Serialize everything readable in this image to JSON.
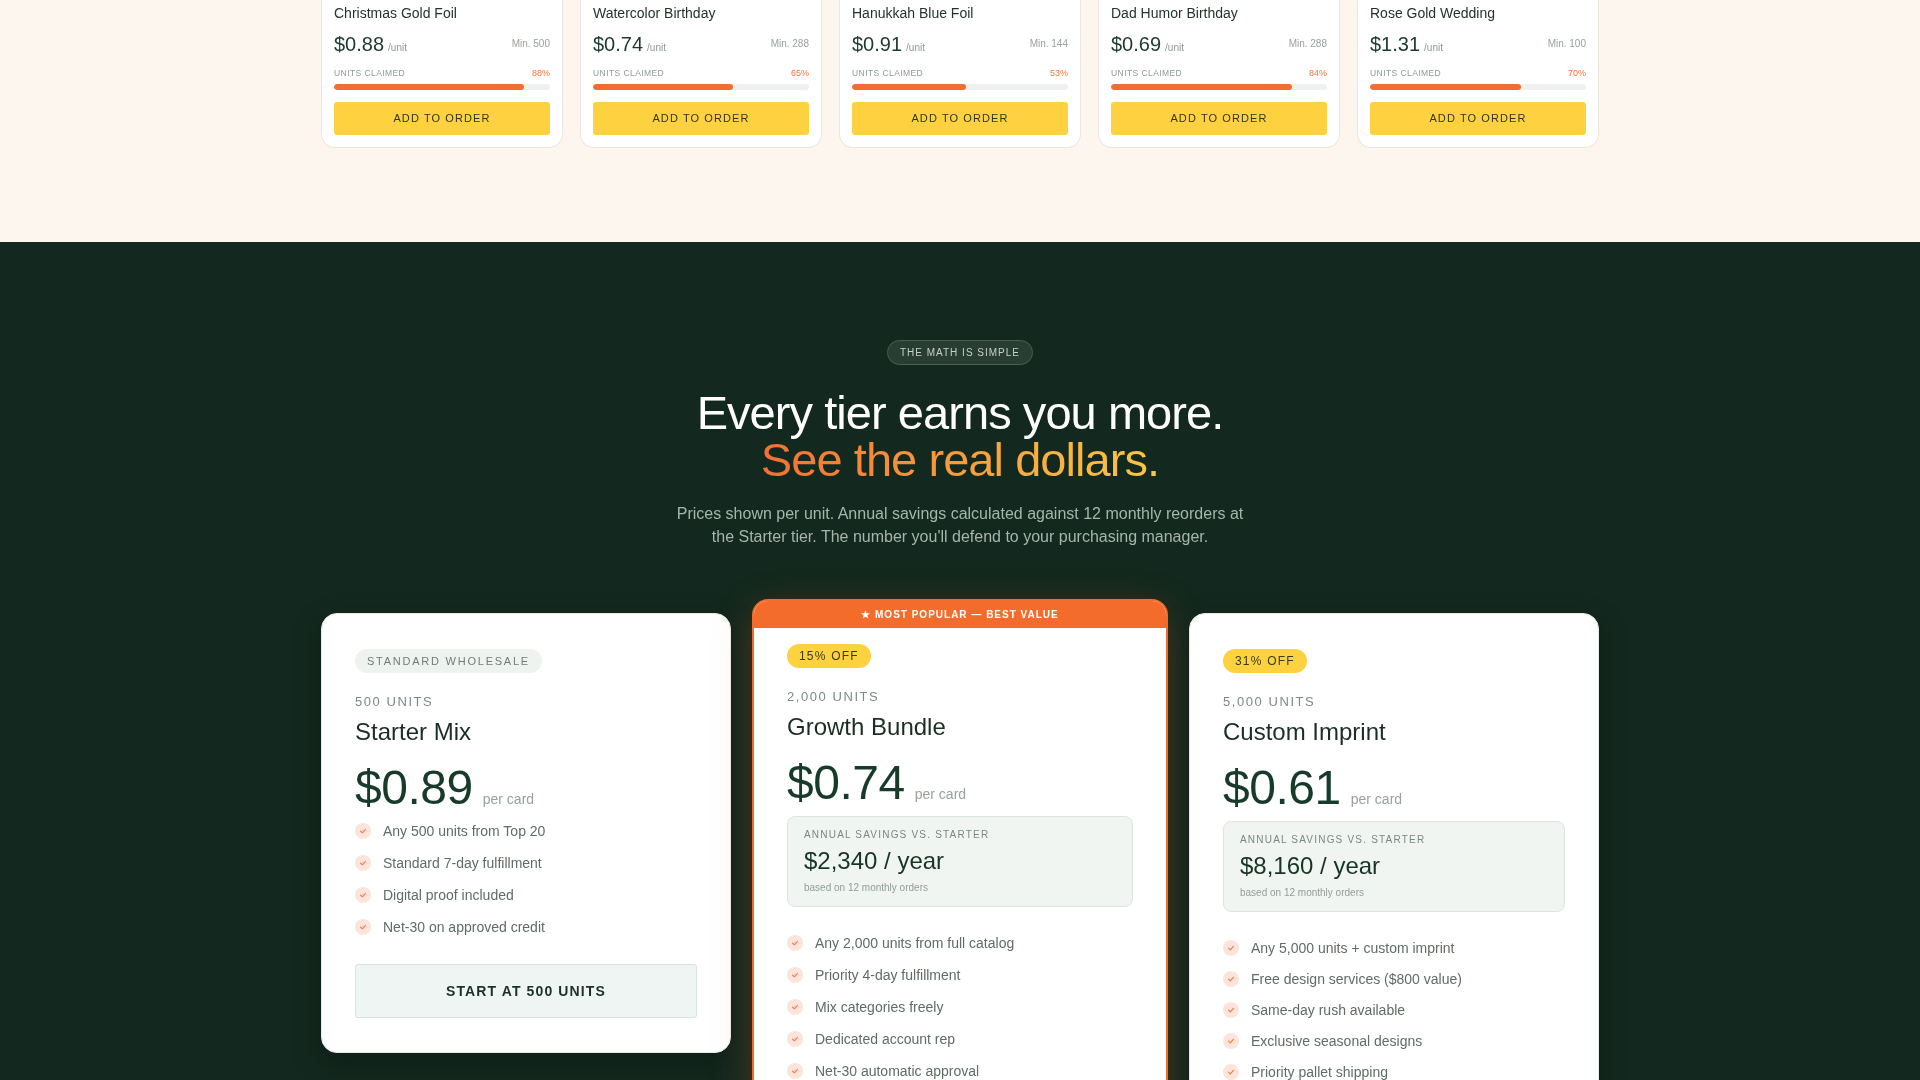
{
  "products": [
    {
      "name": "Christmas Gold Foil",
      "price": "$0.88",
      "unit": "/unit",
      "minimum": "Min. 500",
      "claimed_label": "UNITS CLAIMED",
      "claimed_percent": "88%",
      "level": 0.88,
      "button": "ADD TO ORDER"
    },
    {
      "name": "Watercolor Birthday",
      "price": "$0.74",
      "unit": "/unit",
      "minimum": "Min. 288",
      "claimed_label": "UNITS CLAIMED",
      "claimed_percent": "65%",
      "level": 0.65,
      "button": "ADD TO ORDER"
    },
    {
      "name": "Hanukkah Blue Foil",
      "price": "$0.91",
      "unit": "/unit",
      "minimum": "Min. 144",
      "claimed_label": "UNITS CLAIMED",
      "claimed_percent": "53%",
      "level": 0.53,
      "button": "ADD TO ORDER"
    },
    {
      "name": "Dad Humor Birthday",
      "price": "$0.69",
      "unit": "/unit",
      "minimum": "Min. 288",
      "claimed_label": "UNITS CLAIMED",
      "claimed_percent": "84%",
      "level": 0.84,
      "button": "ADD TO ORDER"
    },
    {
      "name": "Rose Gold Wedding",
      "price": "$1.31",
      "unit": "/unit",
      "minimum": "Min. 100",
      "claimed_label": "UNITS CLAIMED",
      "claimed_percent": "70%",
      "level": 0.7,
      "button": "ADD TO ORDER"
    }
  ],
  "pricing": {
    "eyebrow": "THE MATH IS SIMPLE",
    "headline": "Every tier earns you more.",
    "headline_accent": "See the real dollars.",
    "description": "Prices shown per unit. Annual savings calculated against 12 monthly reorders at the Starter tier. The number you'll defend to your purchasing manager.",
    "tiers": [
      {
        "featured": false,
        "badge": {
          "kind": "neutral",
          "label": "STANDARD WHOLESALE"
        },
        "units": "500 UNITS",
        "name": "Starter Mix",
        "price": "$0.89",
        "price_unit": "per card",
        "features": [
          "Any 500 units from Top 20",
          "Standard 7-day fulfillment",
          "Digital proof included",
          "Net-30 on approved credit"
        ],
        "button": "START AT 500 UNITS"
      },
      {
        "featured": true,
        "ribbon": "★ MOST POPULAR — BEST VALUE",
        "badge": {
          "kind": "discount",
          "label": "15% OFF"
        },
        "units": "2,000 UNITS",
        "name": "Growth Bundle",
        "price": "$0.74",
        "price_unit": "per card",
        "savings": {
          "label": "ANNUAL SAVINGS VS. STARTER",
          "amount": "$2,340 / year",
          "note": "based on 12 monthly orders"
        },
        "features": [
          "Any 2,000 units from full catalog",
          "Priority 4-day fulfillment",
          "Mix categories freely",
          "Dedicated account rep",
          "Net-30 automatic approval"
        ]
      },
      {
        "featured": false,
        "badge": {
          "kind": "discount",
          "label": "31% OFF"
        },
        "units": "5,000 UNITS",
        "name": "Custom Imprint",
        "price": "$0.61",
        "price_unit": "per card",
        "savings": {
          "label": "ANNUAL SAVINGS VS. STARTER",
          "amount": "$8,160 / year",
          "note": "based on 12 monthly orders"
        },
        "features": [
          "Any 5,000 units + custom imprint",
          "Free design services ($800 value)",
          "Same-day rush available",
          "Exclusive seasonal designs",
          "Priority pallet shipping"
        ]
      }
    ]
  }
}
